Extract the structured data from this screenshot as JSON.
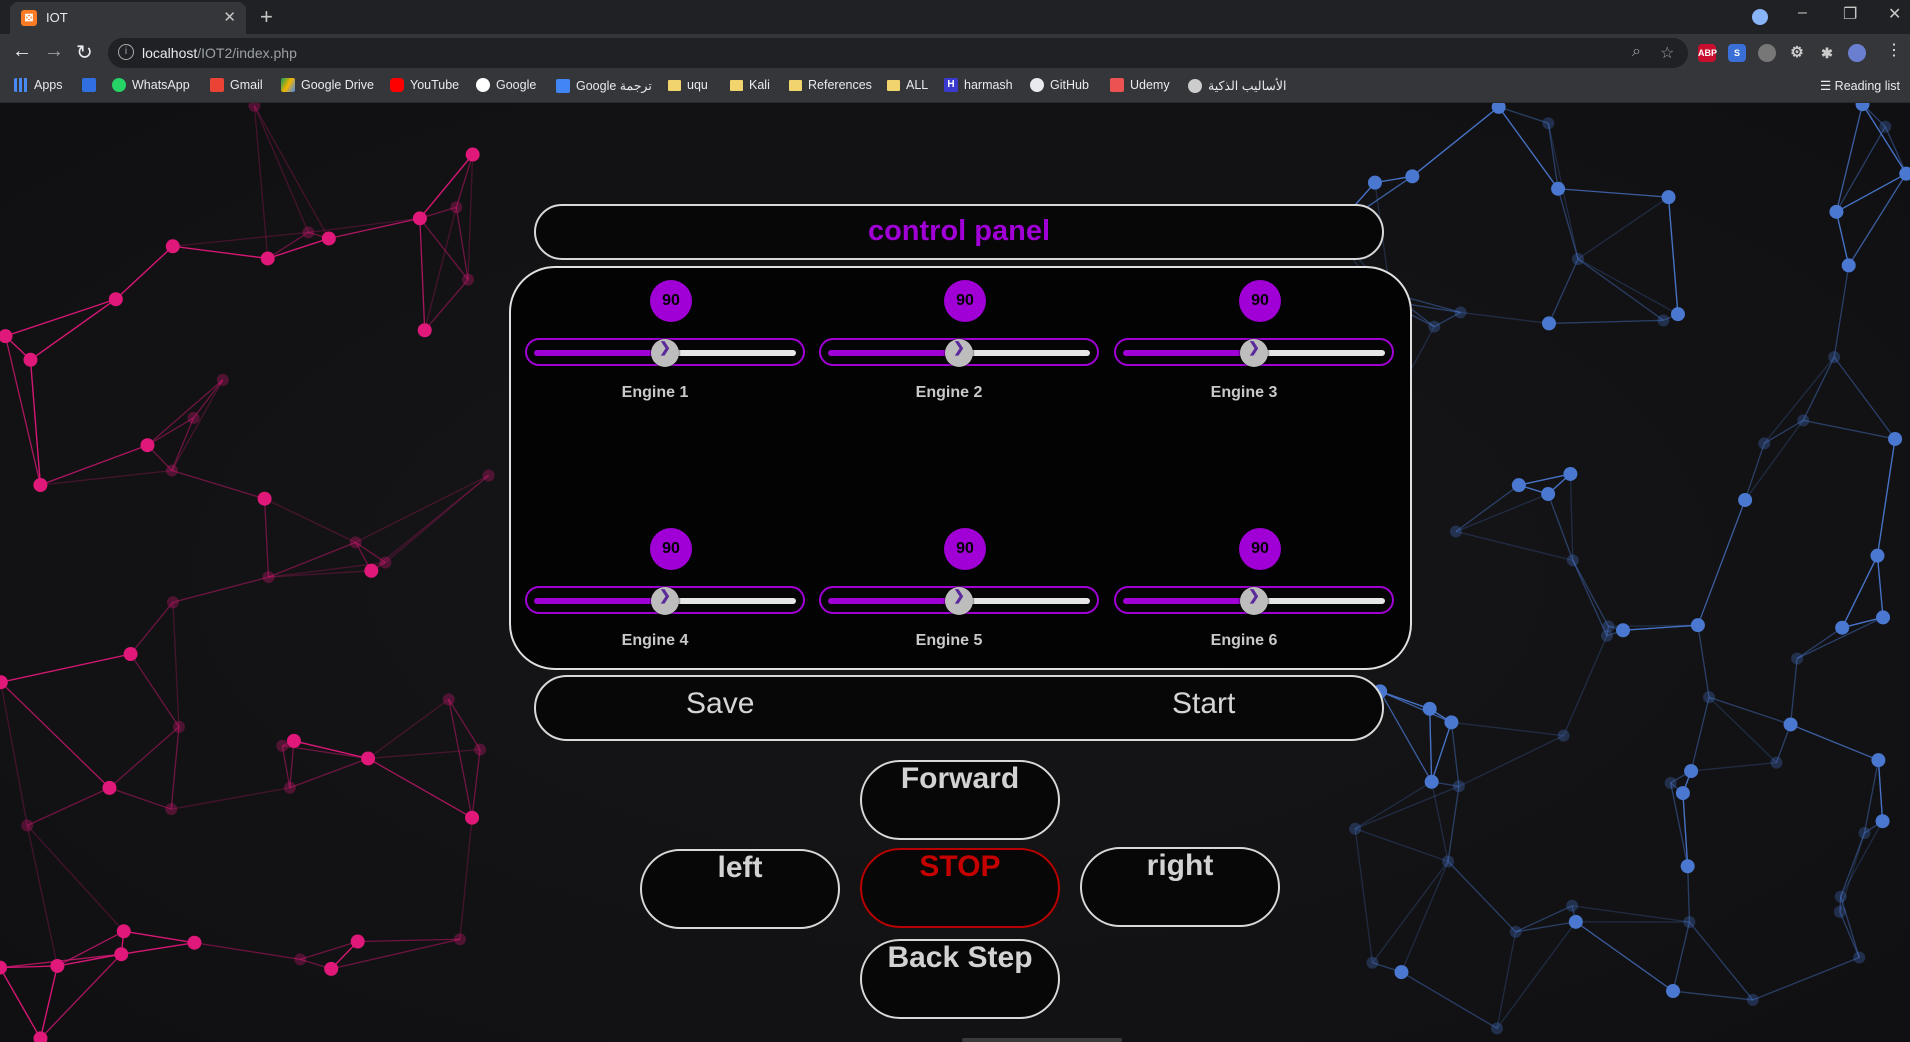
{
  "browser": {
    "tab": {
      "title": "IOT",
      "favicon": "xampp-icon"
    },
    "url": {
      "host": "localhost",
      "path": "/IOT2/index.php"
    },
    "bookmarks": [
      {
        "label": "Apps",
        "icon": "apps-grid-icon"
      },
      {
        "label": "",
        "icon": "bookmark-blue-icon"
      },
      {
        "label": "WhatsApp",
        "icon": "whatsapp-icon"
      },
      {
        "label": "Gmail",
        "icon": "gmail-icon"
      },
      {
        "label": "Google Drive",
        "icon": "google-drive-icon"
      },
      {
        "label": "YouTube",
        "icon": "youtube-icon"
      },
      {
        "label": "Google",
        "icon": "google-icon"
      },
      {
        "label": "Google ترجمة",
        "icon": "google-translate-icon"
      },
      {
        "label": "uqu",
        "icon": "folder-icon"
      },
      {
        "label": "Kali",
        "icon": "folder-icon"
      },
      {
        "label": "References",
        "icon": "folder-icon"
      },
      {
        "label": "ALL",
        "icon": "folder-icon"
      },
      {
        "label": "harmash",
        "icon": "harmash-icon"
      },
      {
        "label": "GitHub",
        "icon": "github-icon"
      },
      {
        "label": "Udemy",
        "icon": "udemy-icon"
      },
      {
        "label": "الأساليب الذكية",
        "icon": "globe-icon"
      }
    ],
    "reading_list": "Reading list"
  },
  "panel": {
    "title": "control panel",
    "engines": [
      {
        "label": "Engine 1",
        "value": "90",
        "level": 0.5
      },
      {
        "label": "Engine 2",
        "value": "90",
        "level": 0.5
      },
      {
        "label": "Engine 3",
        "value": "90",
        "level": 0.5
      },
      {
        "label": "Engine 4",
        "value": "90",
        "level": 0.5
      },
      {
        "label": "Engine 5",
        "value": "90",
        "level": 0.5
      },
      {
        "label": "Engine 6",
        "value": "90",
        "level": 0.5
      }
    ],
    "actions": {
      "save": "Save",
      "start": "Start"
    },
    "directions": {
      "forward": "Forward",
      "left": "left",
      "stop": "STOP",
      "right": "right",
      "back": "Back Step"
    }
  },
  "colors": {
    "accent": "#a000d6",
    "stop": "#c40000",
    "net_left": "#e0187a",
    "net_right": "#4a78d0"
  }
}
